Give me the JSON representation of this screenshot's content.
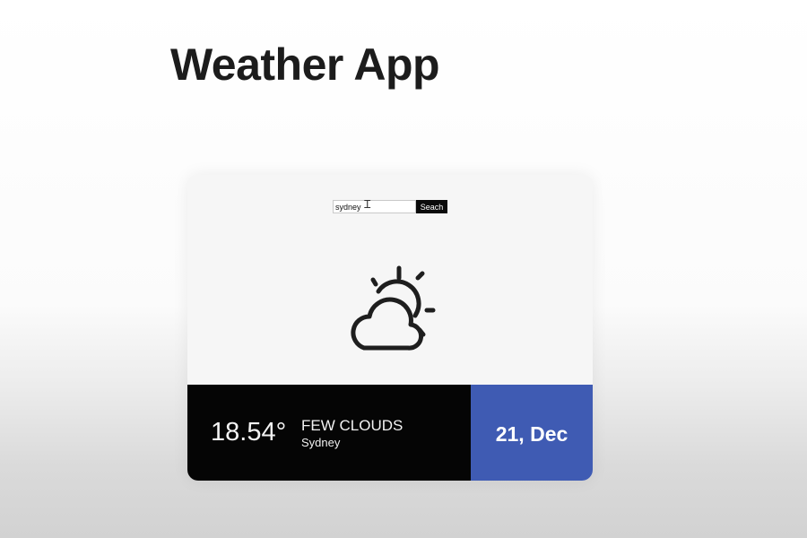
{
  "app": {
    "title": "Weather App"
  },
  "search": {
    "value": "sydney",
    "button_label": "Seach"
  },
  "weather": {
    "icon": "sun-behind-cloud-icon",
    "temperature": "18.54°",
    "condition": "FEW CLOUDS",
    "city": "Sydney",
    "date": "21, Dec"
  },
  "colors": {
    "accent": "#3f5bb3",
    "dark_panel": "#050505",
    "card_background": "#f6f6f6",
    "icon_stroke": "#1e1e1e"
  }
}
